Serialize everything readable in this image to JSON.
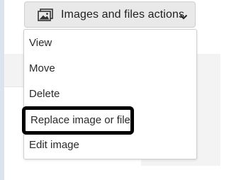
{
  "button": {
    "label": "Images and files actions",
    "icon": "image-icon",
    "chevron": "chevron-down-icon"
  },
  "menu": {
    "items": [
      {
        "label": "View"
      },
      {
        "label": "Move"
      },
      {
        "label": "Delete"
      },
      {
        "label": "Replace image or file",
        "highlighted": true
      },
      {
        "label": "Edit image"
      }
    ]
  },
  "colors": {
    "highlight_border": "#000000",
    "button_bg": "#e9e9e9",
    "menu_bg": "#ffffff"
  }
}
